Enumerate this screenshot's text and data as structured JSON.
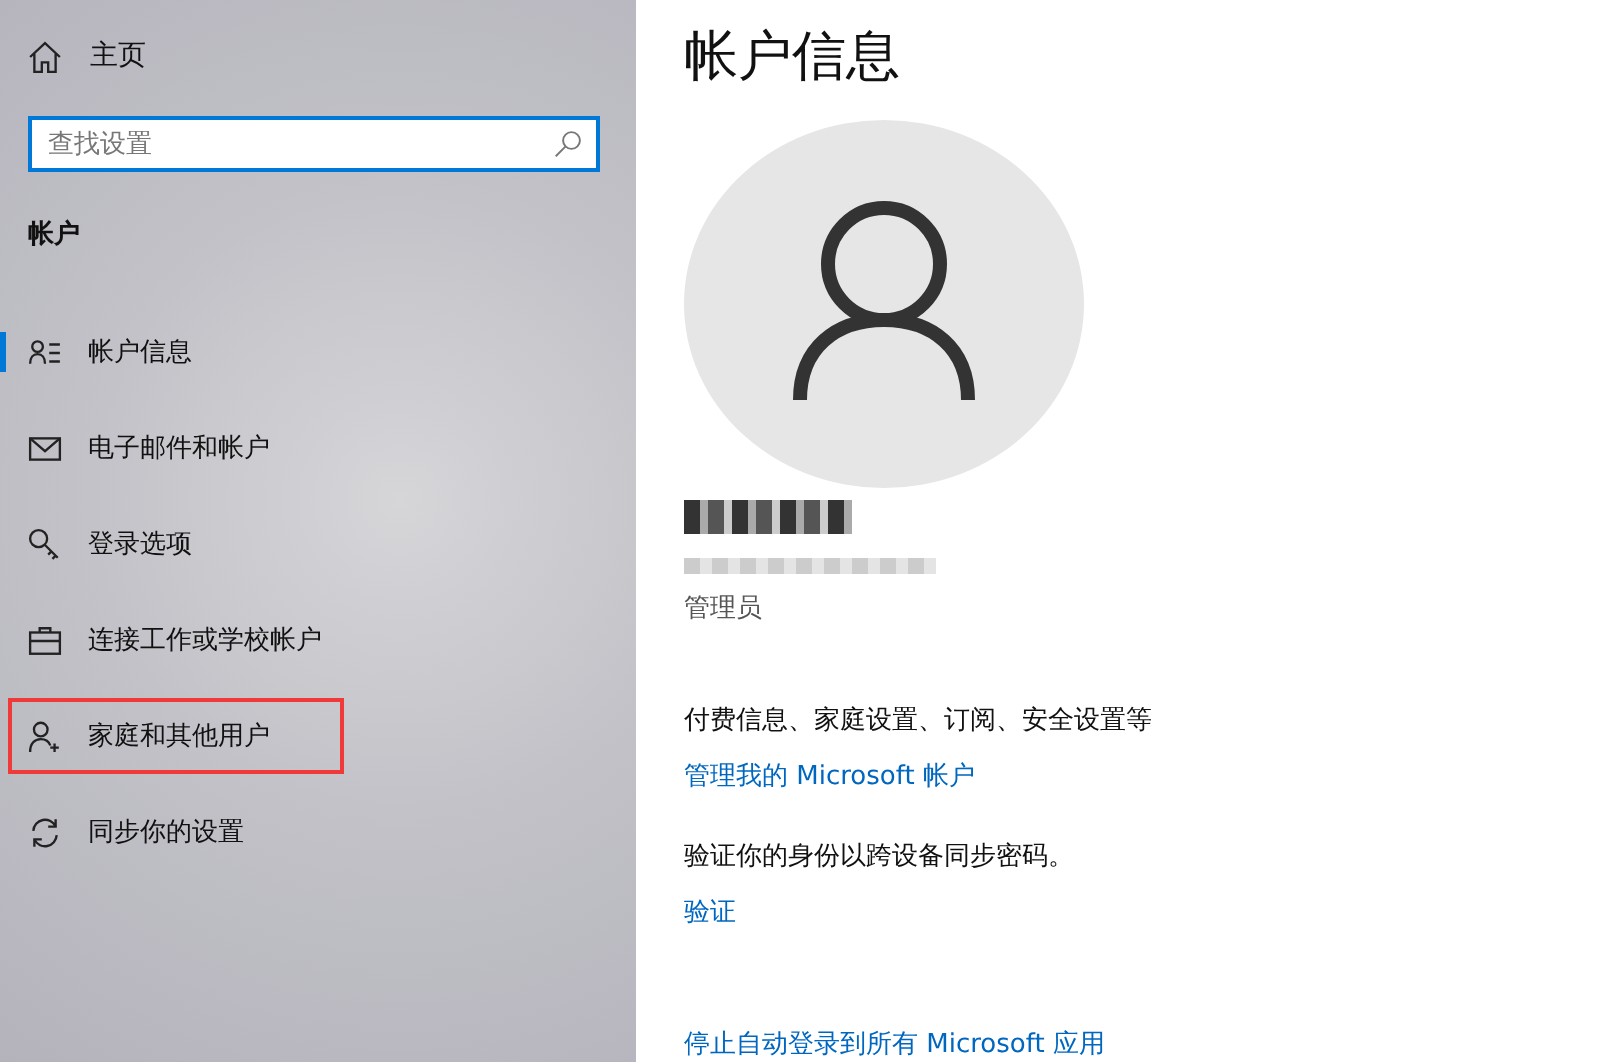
{
  "sidebar": {
    "home": {
      "label": "主页"
    },
    "search": {
      "placeholder": "查找设置"
    },
    "section_title": "帐户",
    "items": [
      {
        "kind": "info",
        "label": "帐户信息",
        "selected": true,
        "highlighted": false
      },
      {
        "kind": "mail",
        "label": "电子邮件和帐户",
        "selected": false,
        "highlighted": false
      },
      {
        "kind": "key",
        "label": "登录选项",
        "selected": false,
        "highlighted": false
      },
      {
        "kind": "briefcase",
        "label": "连接工作或学校帐户",
        "selected": false,
        "highlighted": false
      },
      {
        "kind": "person-add",
        "label": "家庭和其他用户",
        "selected": false,
        "highlighted": true
      },
      {
        "kind": "sync",
        "label": "同步你的设置",
        "selected": false,
        "highlighted": false
      }
    ]
  },
  "main": {
    "title": "帐户信息",
    "role": "管理员",
    "blocks": [
      {
        "kind": "text",
        "text": "付费信息、家庭设置、订阅、安全设置等"
      },
      {
        "kind": "link",
        "text": "管理我的 Microsoft 帐户"
      },
      {
        "kind": "text",
        "text": "验证你的身份以跨设备同步密码。"
      },
      {
        "kind": "link",
        "text": "验证"
      },
      {
        "kind": "link",
        "text": "停止自动登录到所有 Microsoft 应用"
      }
    ]
  }
}
